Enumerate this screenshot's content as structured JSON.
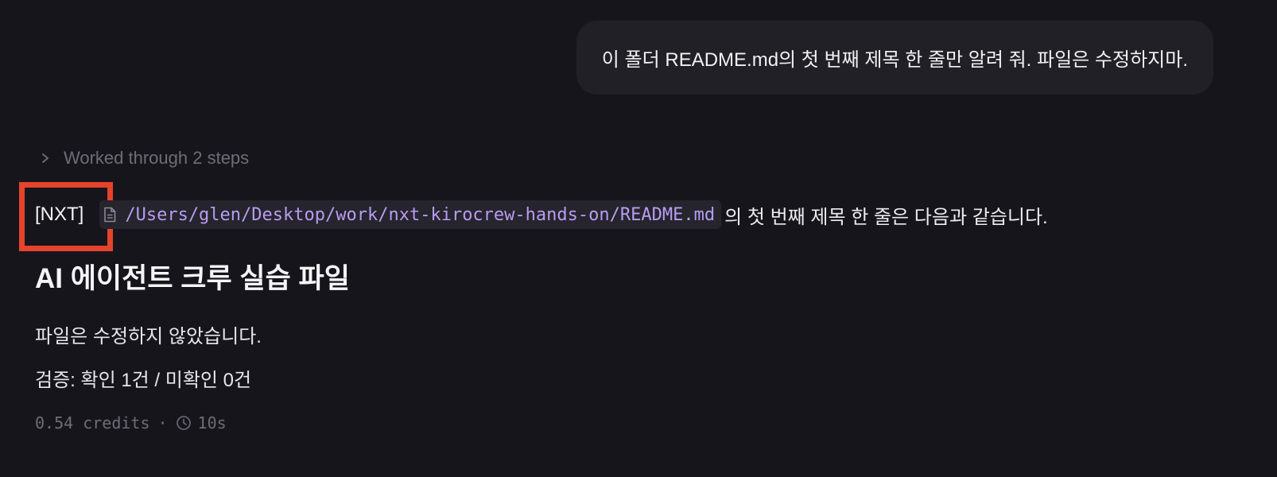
{
  "user_message": {
    "text": "이 폴더 README.md의 첫 번째 제목 한 줄만 알려 줘. 파일은 수정하지마."
  },
  "steps": {
    "label": "Worked through 2 steps",
    "icon": "chevron-right-icon"
  },
  "answer": {
    "tag": "[NXT]",
    "file_path": "/Users/glen/Desktop/work/nxt-kirocrew-hands-on/README.md",
    "file_icon": "file-icon",
    "suffix": "의 첫 번째 제목 한 줄은 다음과 같습니다.",
    "heading": "AI 에이전트 크루 실습 파일",
    "paragraphs": [
      "파일은 수정하지 않았습니다.",
      "검증: 확인 1건 / 미확인 0건"
    ]
  },
  "meta": {
    "credits": "0.54 credits",
    "separator": "·",
    "duration": "10s",
    "clock_icon": "clock-icon"
  },
  "colors": {
    "background": "#17151c",
    "bubble": "#222027",
    "highlight_box": "#e6432c",
    "file_path": "#b79cf3",
    "muted": "#6f6c76"
  }
}
